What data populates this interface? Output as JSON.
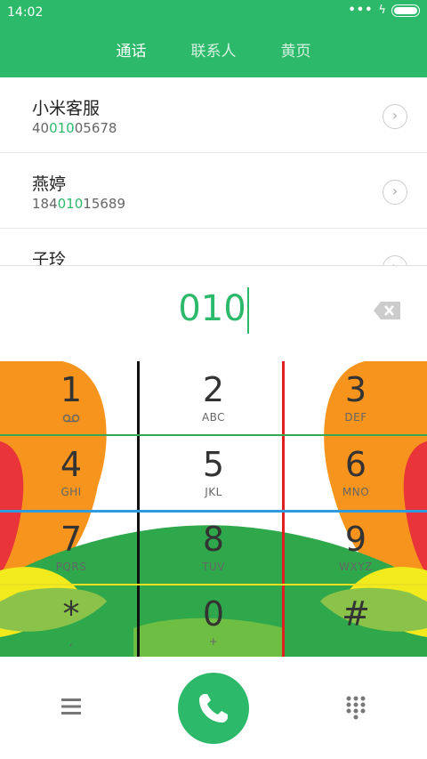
{
  "status": {
    "time": "14:02"
  },
  "tabs": [
    {
      "label": "通话",
      "active": true
    },
    {
      "label": "联系人",
      "active": false
    },
    {
      "label": "黄页",
      "active": false
    }
  ],
  "contacts": [
    {
      "name": "小米客服",
      "number_pre": "40",
      "number_hl": "010",
      "number_post": "05678"
    },
    {
      "name": "燕婷",
      "number_pre": "184",
      "number_hl": "010",
      "number_post": "15689"
    },
    {
      "name": "子玲",
      "number_pre": "",
      "number_hl": "",
      "number_post": ""
    }
  ],
  "dialer": {
    "input": "010"
  },
  "keys": [
    {
      "digit": "1",
      "letters": ""
    },
    {
      "digit": "2",
      "letters": "ABC"
    },
    {
      "digit": "3",
      "letters": "DEF"
    },
    {
      "digit": "4",
      "letters": "GHI"
    },
    {
      "digit": "5",
      "letters": "JKL"
    },
    {
      "digit": "6",
      "letters": "MNO"
    },
    {
      "digit": "7",
      "letters": "PQRS"
    },
    {
      "digit": "8",
      "letters": "TUV"
    },
    {
      "digit": "9",
      "letters": "WXYZ"
    },
    {
      "digit": "*",
      "letters": ","
    },
    {
      "digit": "0",
      "letters": "+"
    },
    {
      "digit": "#",
      "letters": ""
    }
  ],
  "colors": {
    "accent": "#2cb96a",
    "line_black": "#111111",
    "line_red": "#e02020",
    "line_green": "#34a853",
    "line_blue": "#2e9be0",
    "line_yellow": "#e8e020"
  },
  "icons": {
    "voicemail": "voicemail-icon",
    "backspace": "backspace-icon",
    "menu": "menu-icon",
    "call": "phone-icon",
    "keypad": "keypad-icon",
    "detail": "chevron-right-icon"
  }
}
